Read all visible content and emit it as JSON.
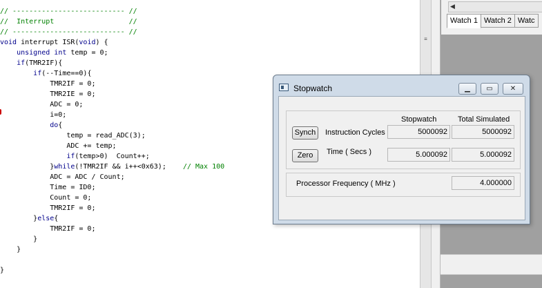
{
  "editor": {
    "lines": [
      {
        "cls": "cm",
        "text": "// --------------------------- //"
      },
      {
        "cls": "cm",
        "text": "//  Interrupt                  //"
      },
      {
        "cls": "cm",
        "text": "// --------------------------- //"
      },
      {
        "cls": "",
        "text": "void interrupt ISR(void) {"
      },
      {
        "cls": "",
        "text": "    unsigned int temp = 0;"
      },
      {
        "cls": "",
        "text": "    if(TMR2IF){"
      },
      {
        "cls": "",
        "text": "        if(--Time==0){"
      },
      {
        "cls": "",
        "text": "            TMR2IF = 0;"
      },
      {
        "cls": "",
        "text": "            TMR2IE = 0;"
      },
      {
        "cls": "",
        "text": "            ADC = 0;"
      },
      {
        "cls": "",
        "text": "            i=0;"
      },
      {
        "cls": "",
        "text": "            do{"
      },
      {
        "cls": "",
        "text": "                temp = read_ADC(3);"
      },
      {
        "cls": "",
        "text": "                ADC += temp;"
      },
      {
        "cls": "",
        "text": "                if(temp>0)  Count++;"
      },
      {
        "cls": "",
        "text": "            }while(!TMR2IF && i++<0x63);    // Max 100"
      },
      {
        "cls": "",
        "text": "            ADC = ADC / Count;"
      },
      {
        "cls": "",
        "text": "            Time = ID0;"
      },
      {
        "cls": "",
        "text": "            Count = 0;"
      },
      {
        "cls": "",
        "text": "            TMR2IF = 0;"
      },
      {
        "cls": "",
        "text": "        }else{"
      },
      {
        "cls": "",
        "text": "            TMR2IF = 0;"
      },
      {
        "cls": "",
        "text": "        }"
      },
      {
        "cls": "",
        "text": "    }"
      },
      {
        "cls": "",
        "text": ""
      },
      {
        "cls": "",
        "text": "}"
      }
    ]
  },
  "watch": {
    "tabs": [
      "Watch 1",
      "Watch 2",
      "Watc"
    ]
  },
  "stopwatch": {
    "title": "Stopwatch",
    "header_stopwatch": "Stopwatch",
    "header_total": "Total Simulated",
    "synch_label": "Synch",
    "zero_label": "Zero",
    "instruction_label": "Instruction  Cycles",
    "time_label": "Time   ( Secs )",
    "cycles_stopwatch": "5000092",
    "cycles_total": "5000092",
    "time_stopwatch": "5.000092",
    "time_total": "5.000092",
    "freq_label": "Processor Frequency    ( MHz )",
    "freq_value": "4.000000"
  },
  "colors": {
    "comment": "#008000",
    "keyword": "#00008b",
    "window_frame": "#cfdbe8",
    "dialog_bg": "#f0f0f0"
  }
}
